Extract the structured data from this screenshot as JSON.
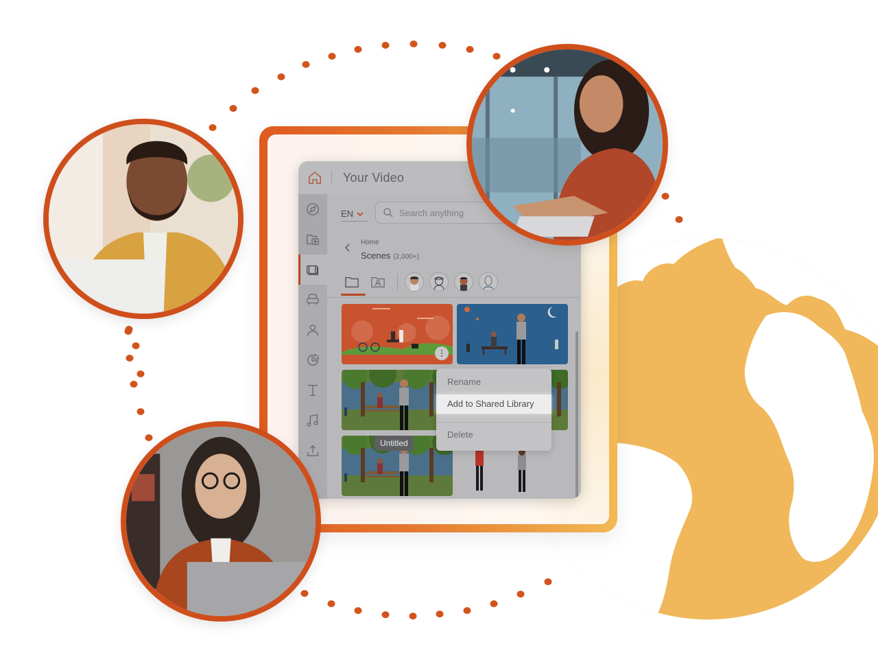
{
  "colors": {
    "brand_orange": "#cf4f1c",
    "dot_orange": "#d2541c",
    "globe_yellow": "#f0b85a",
    "frame_gradient_start": "#de5b1f",
    "frame_gradient_end": "#f2b954",
    "active_indicator": "#b5481c"
  },
  "app": {
    "title": "Your Video",
    "home_icon": "home-icon",
    "sidebar": {
      "items": [
        {
          "icon": "compass-icon",
          "label": "Explore",
          "group": "top"
        },
        {
          "icon": "video-folder-icon",
          "label": "Media",
          "group": "top"
        },
        {
          "icon": "scenes-icon",
          "label": "Scenes",
          "active": true
        },
        {
          "icon": "props-icon",
          "label": "Props"
        },
        {
          "icon": "user-icon",
          "label": "Characters"
        },
        {
          "icon": "chart-icon",
          "label": "Charts"
        },
        {
          "icon": "text-icon",
          "label": "Text"
        },
        {
          "icon": "music-icon",
          "label": "Audio"
        },
        {
          "icon": "upload-icon",
          "label": "Upload"
        }
      ]
    },
    "language": {
      "selected": "EN"
    },
    "search": {
      "placeholder": "Search anything",
      "value": ""
    },
    "breadcrumb": {
      "parent": "Home",
      "title": "Scenes",
      "count": "(2,000+)"
    },
    "tabs": [
      {
        "icon": "folder-icon",
        "active": true
      },
      {
        "icon": "user-folder-icon"
      },
      {
        "icon": "avatar-1",
        "type": "character"
      },
      {
        "icon": "avatar-2",
        "type": "character"
      },
      {
        "icon": "avatar-3",
        "type": "character"
      },
      {
        "icon": "avatar-4",
        "type": "character"
      }
    ],
    "scenes": [
      {
        "name": "Park bikes scene",
        "theme": "orange"
      },
      {
        "name": "Night park scene",
        "theme": "blue"
      },
      {
        "name": "Forest bench scene",
        "theme": "green"
      },
      {
        "name": "Forest bench scene 2",
        "theme": "green"
      },
      {
        "name": "Untitled",
        "theme": "green",
        "tooltip": "Untitled"
      },
      {
        "name": "Characters standing",
        "theme": "plain"
      }
    ],
    "context_menu": {
      "items": [
        {
          "label": "Rename",
          "highlighted": false
        },
        {
          "label": "Add to Shared Library",
          "highlighted": true
        },
        {
          "label": "Delete",
          "highlighted": false
        }
      ]
    }
  },
  "portraits": [
    {
      "name": "Man in mustard shirt at laptop"
    },
    {
      "name": "Woman with curly hair typing"
    },
    {
      "name": "Woman with glasses at laptop"
    }
  ]
}
